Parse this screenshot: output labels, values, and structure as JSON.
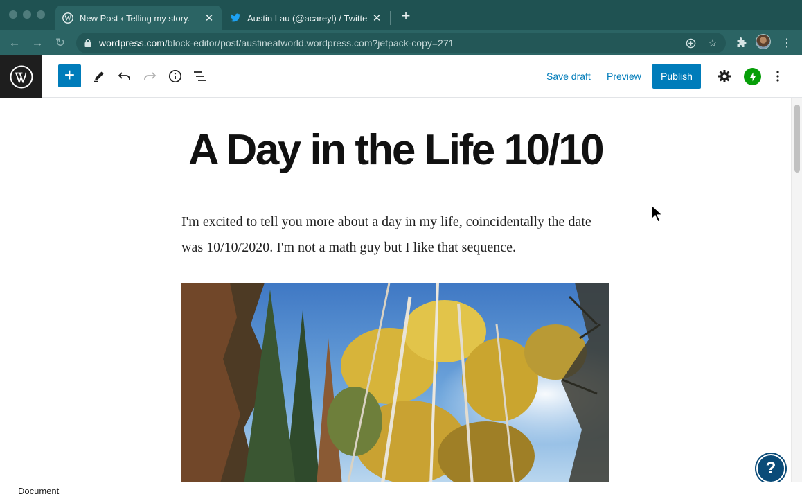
{
  "browser": {
    "tabs": [
      {
        "title": "New Post ‹ Telling my story. —",
        "favicon": "wordpress-icon",
        "active": true
      },
      {
        "title": "Austin Lau (@acareyl) / Twitter",
        "favicon": "twitter-icon",
        "active": false
      }
    ],
    "url_domain": "wordpress.com",
    "url_path": "/block-editor/post/austineatworld.wordpress.com?jetpack-copy=271"
  },
  "editor": {
    "toolbar": {
      "save_draft": "Save draft",
      "preview": "Preview",
      "publish": "Publish"
    },
    "post": {
      "title": "A Day in the Life 10/10",
      "paragraph": "I'm excited to tell you more about a day in my life, coincidentally the date was 10/10/2020. I'm not a math guy but I like that sequence.",
      "image_alt": "Looking up at aspen and pine trees with golden autumn leaves against a blue sky"
    },
    "footer": {
      "breadcrumb": "Document"
    },
    "help_label": "?"
  },
  "colors": {
    "accent": "#007cba",
    "wp_logo_bg": "#1e1e1e",
    "jetpack": "#069e08",
    "browser_frame": "#2b6464"
  }
}
